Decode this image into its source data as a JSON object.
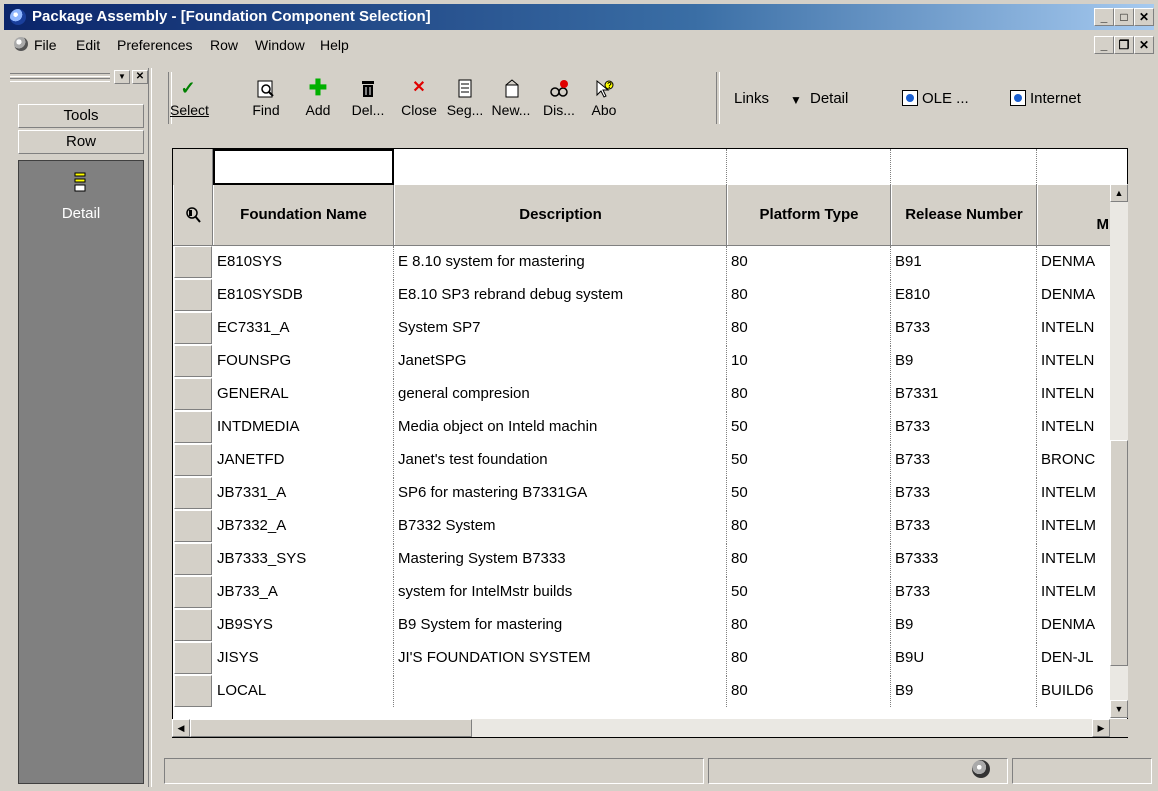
{
  "window": {
    "title": "Package Assembly - [Foundation Component Selection]"
  },
  "menu": [
    "File",
    "Edit",
    "Preferences",
    "Row",
    "Window",
    "Help"
  ],
  "left_panel": {
    "tools_label": "Tools",
    "row_label": "Row",
    "detail_label": "Detail"
  },
  "toolbar": {
    "buttons": [
      {
        "label": "Select",
        "icon": "checkmark-icon"
      },
      {
        "label": "Find",
        "icon": "find-icon"
      },
      {
        "label": "Add",
        "icon": "add-icon"
      },
      {
        "label": "Del...",
        "icon": "trash-icon"
      },
      {
        "label": "Close",
        "icon": "close-icon"
      },
      {
        "label": "Seg...",
        "icon": "segment-icon"
      },
      {
        "label": "New...",
        "icon": "new-icon"
      },
      {
        "label": "Dis...",
        "icon": "display-icon"
      },
      {
        "label": "Abo",
        "icon": "about-icon"
      }
    ],
    "links_label": "Links",
    "detail_label": "Detail",
    "ole_label": "OLE ...",
    "internet_label": "Internet"
  },
  "grid": {
    "headers": {
      "foundation_name": "Foundation Name",
      "description": "Description",
      "platform_type": "Platform Type",
      "release_number": "Release Number",
      "partial": "M"
    },
    "rows": [
      {
        "name": "E810SYS",
        "description": "E 8.10 system for mastering",
        "platform": "80",
        "release": "B91",
        "machine": "DENMA"
      },
      {
        "name": "E810SYSDB",
        "description": "E8.10 SP3 rebrand debug system",
        "platform": "80",
        "release": "E810",
        "machine": "DENMA"
      },
      {
        "name": "EC7331_A",
        "description": "System SP7",
        "platform": "80",
        "release": "B733",
        "machine": "INTELN"
      },
      {
        "name": "FOUNSPG",
        "description": "JanetSPG",
        "platform": "10",
        "release": "B9",
        "machine": "INTELN"
      },
      {
        "name": "GENERAL",
        "description": "general compresion",
        "platform": "80",
        "release": "B7331",
        "machine": "INTELN"
      },
      {
        "name": "INTDMEDIA",
        "description": "Media object on Inteld machin",
        "platform": "50",
        "release": "B733",
        "machine": "INTELN"
      },
      {
        "name": "JANETFD",
        "description": "Janet's test foundation",
        "platform": "50",
        "release": "B733",
        "machine": "BRONC"
      },
      {
        "name": "JB7331_A",
        "description": "SP6 for mastering B7331GA",
        "platform": "50",
        "release": "B733",
        "machine": "INTELM"
      },
      {
        "name": "JB7332_A",
        "description": "B7332 System",
        "platform": "80",
        "release": "B733",
        "machine": "INTELM"
      },
      {
        "name": "JB7333_SYS",
        "description": "Mastering System B7333",
        "platform": "80",
        "release": "B7333",
        "machine": "INTELM"
      },
      {
        "name": "JB733_A",
        "description": "system for IntelMstr builds",
        "platform": "50",
        "release": "B733",
        "machine": "INTELM"
      },
      {
        "name": "JB9SYS",
        "description": "B9 System for mastering",
        "platform": "80",
        "release": "B9",
        "machine": "DENMA"
      },
      {
        "name": "JISYS",
        "description": "JI'S FOUNDATION SYSTEM",
        "platform": "80",
        "release": "B9U",
        "machine": "DEN-JL"
      },
      {
        "name": "LOCAL",
        "description": "",
        "platform": "80",
        "release": "B9",
        "machine": "BUILD6"
      }
    ]
  }
}
